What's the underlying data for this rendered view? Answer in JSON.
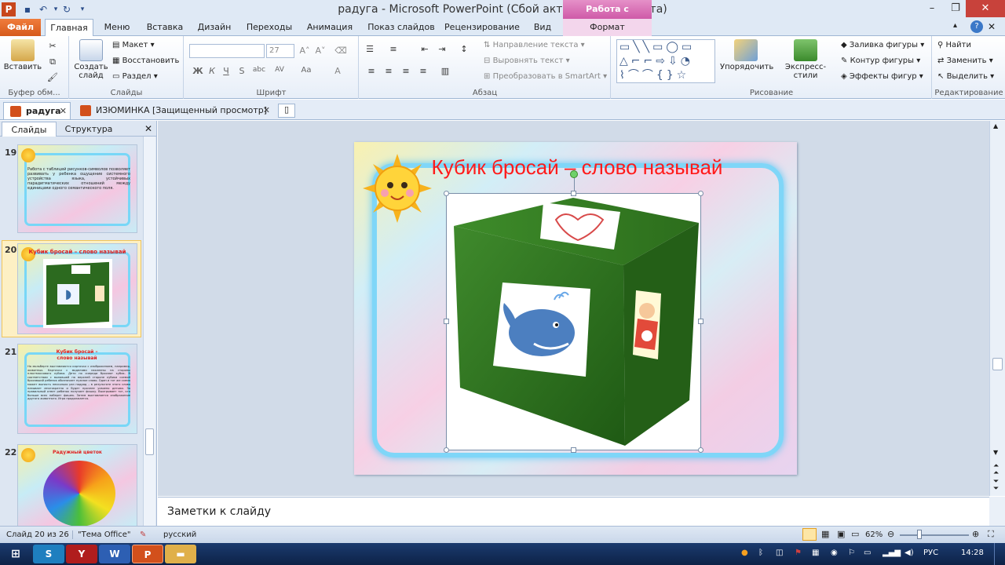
{
  "window": {
    "title": "радуга - Microsoft PowerPoint (Сбой активации продукта)",
    "context_header": "Работа с рисунками"
  },
  "ribbon_tabs": [
    "Файл",
    "Главная",
    "Меню",
    "Вставка",
    "Дизайн",
    "Переходы",
    "Анимация",
    "Показ слайдов",
    "Рецензирование",
    "Вид",
    "Формат"
  ],
  "ribbon": {
    "clipboard": {
      "paste": "Вставить",
      "group": "Буфер обм..."
    },
    "slides": {
      "new_slide": "Создать слайд",
      "layout": "Макет",
      "reset": "Восстановить",
      "section": "Раздел",
      "group": "Слайды"
    },
    "font": {
      "font_name": "",
      "font_size": "27",
      "group": "Шрифт",
      "bold": "Ж",
      "italic": "К",
      "underline": "Ч",
      "strike": "S",
      "shadow": "abc",
      "spacing": "AV",
      "case": "Aa"
    },
    "paragraph": {
      "text_direction": "Направление текста",
      "align_text": "Выровнять текст",
      "smartart": "Преобразовать в SmartArt",
      "group": "Абзац"
    },
    "drawing": {
      "arrange": "Упорядочить",
      "quick_styles": "Экспресс-стили",
      "fill": "Заливка фигуры",
      "outline": "Контур фигуры",
      "effects": "Эффекты фигур",
      "group": "Рисование"
    },
    "editing": {
      "find": "Найти",
      "replace": "Заменить",
      "select": "Выделить",
      "group": "Редактирование"
    }
  },
  "doc_tabs": [
    {
      "label": "радуга"
    },
    {
      "label": "ИЗЮМИНКА [Защищенный просмотр]"
    }
  ],
  "left_panel": {
    "tabs": [
      "Слайды",
      "Структура"
    ],
    "thumbs": [
      {
        "num": "19",
        "text": "Работа с таблицей рисунков-символов позволяет развивать у ребенка ощущение системного устройства языка, устойчивых парадигматических отношений между единицами одного семантического поля."
      },
      {
        "num": "20",
        "title": "Кубик бросай – слово называй"
      },
      {
        "num": "21",
        "title": "Кубик бросай – слово называй",
        "text": "На мольберте выставляются карточки с изображением, например, животных. Карточки с моделями наклеены на стороны пластмассового кубика. Дети по очереди бросают кубик. В соответствии с выпавшей на верхней стороне кубика схемой бросавший ребенок обозначает нужное слово. Один и тот же схема может выпасть несколько раз подряд – в результате этого слово называет многократно и будет прочнее усвоено детьми. За правильный ответ ребенок получает фишку. Выигрывает тот, кто больше всех наберет фишек. Затем выставляется изображение другого животного. Игра продолжается."
      },
      {
        "num": "22",
        "title": "Радужный цветок"
      }
    ]
  },
  "slide": {
    "title": "Кубик бросай – слово называй"
  },
  "notes": {
    "placeholder": "Заметки к слайду"
  },
  "status": {
    "slide_info": "Слайд 20 из 26",
    "theme": "\"Тема Office\"",
    "language": "русский",
    "zoom": "62%"
  },
  "taskbar": {
    "language": "РУС",
    "time": "14:28"
  }
}
